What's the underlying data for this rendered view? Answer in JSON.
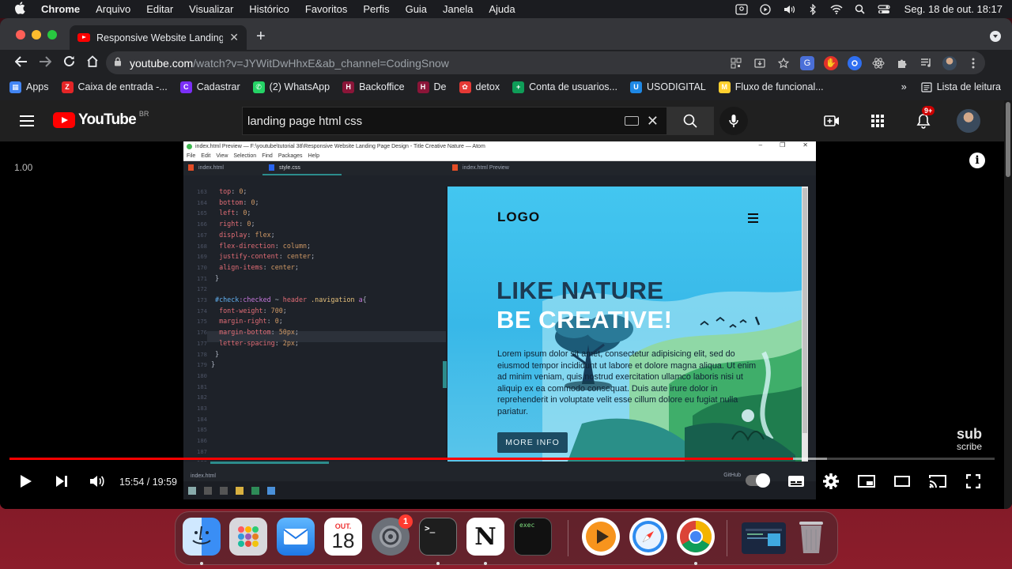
{
  "menubar": {
    "app_name": "Chrome",
    "menus": [
      "Arquivo",
      "Editar",
      "Visualizar",
      "Histórico",
      "Favoritos",
      "Perfis",
      "Guia",
      "Janela",
      "Ajuda"
    ],
    "clock": "Seg. 18 de out.  18:17"
  },
  "browser": {
    "tab_title": "Responsive Website Landing P",
    "url_host": "youtube.com",
    "url_path": "/watch?v=JYWitDwHhxE&ab_channel=CodingSnow",
    "bookmarks": [
      {
        "label": "Apps",
        "icon": "apps-grid-icon",
        "color": "#4285f4",
        "glyph": "▦"
      },
      {
        "label": "Caixa de entrada -...",
        "icon": "zoho-mail-icon",
        "color": "#e42527",
        "glyph": "Z"
      },
      {
        "label": "Cadastrar",
        "icon": "cadastrar-icon",
        "color": "#7b2ff7",
        "glyph": "C"
      },
      {
        "label": "(2) WhatsApp",
        "icon": "whatsapp-icon",
        "color": "#25d366",
        "glyph": "✆"
      },
      {
        "label": "Backoffice",
        "icon": "backoffice-icon",
        "color": "#8a1538",
        "glyph": "H"
      },
      {
        "label": "De",
        "icon": "de-icon",
        "color": "#8a1538",
        "glyph": "H"
      },
      {
        "label": "detox",
        "icon": "detox-icon",
        "color": "#e53935",
        "glyph": "✿"
      },
      {
        "label": "Conta de usuarios...",
        "icon": "sheets-icon",
        "color": "#0f9d58",
        "glyph": "+"
      },
      {
        "label": "USODIGITAL",
        "icon": "usodigital-icon",
        "color": "#1e88e5",
        "glyph": "U"
      },
      {
        "label": "Fluxo de funcional...",
        "icon": "miro-icon",
        "color": "#ffd02f",
        "glyph": "M"
      }
    ],
    "bookmarks_more": "»",
    "reading_list": "Lista de leitura"
  },
  "youtube": {
    "region": "BR",
    "search_query": "landing page html css",
    "notification_count": "9+",
    "speed_label": "1.00",
    "time_current": "15:54",
    "time_total": "19:59",
    "progress_fraction": 0.7955,
    "buffer_end_fraction": 0.83,
    "watermark_top": "sub",
    "watermark_bottom": "scribe"
  },
  "video": {
    "atom_title": "index.html Preview — F:\\youtube\\tutorial 38\\Responsive Website Landing Page Design - Title Creative Nature — Atom",
    "atom_menu": [
      "File",
      "Edit",
      "View",
      "Selection",
      "Find",
      "Packages",
      "Help"
    ],
    "tabs": [
      "index.html",
      "style.css",
      "index.html Preview"
    ],
    "line_numbers": [
      "163",
      "164",
      "165",
      "166",
      "167",
      "168",
      "169",
      "170",
      "171",
      "172",
      "173",
      "174",
      "175",
      "176",
      "177",
      "178",
      "179",
      "180",
      "181",
      "182",
      "183",
      "184",
      "185",
      "186",
      "187",
      "188"
    ],
    "status_file": "index.html",
    "status_github": "GitHub",
    "landing": {
      "logo": "LOGO",
      "headline_1": "LIKE NATURE",
      "headline_2": "BE CREATIVE!",
      "body": "Lorem ipsum dolor sit amet, consectetur adipisicing elit, sed do eiusmod tempor incididunt ut labore et dolore magna aliqua. Ut enim ad minim veniam, quis nostrud exercitation ullamco laboris nisi ut aliquip ex ea commodo consequat. Duis aute irure dolor in reprehenderit in voluptate velit esse cillum dolore eu fugiat nulla pariatur.",
      "button": "MORE INFO"
    }
  },
  "dock": {
    "calendar_month": "OUT.",
    "calendar_day": "18",
    "settings_badge": "1",
    "exec_label": "exec"
  }
}
